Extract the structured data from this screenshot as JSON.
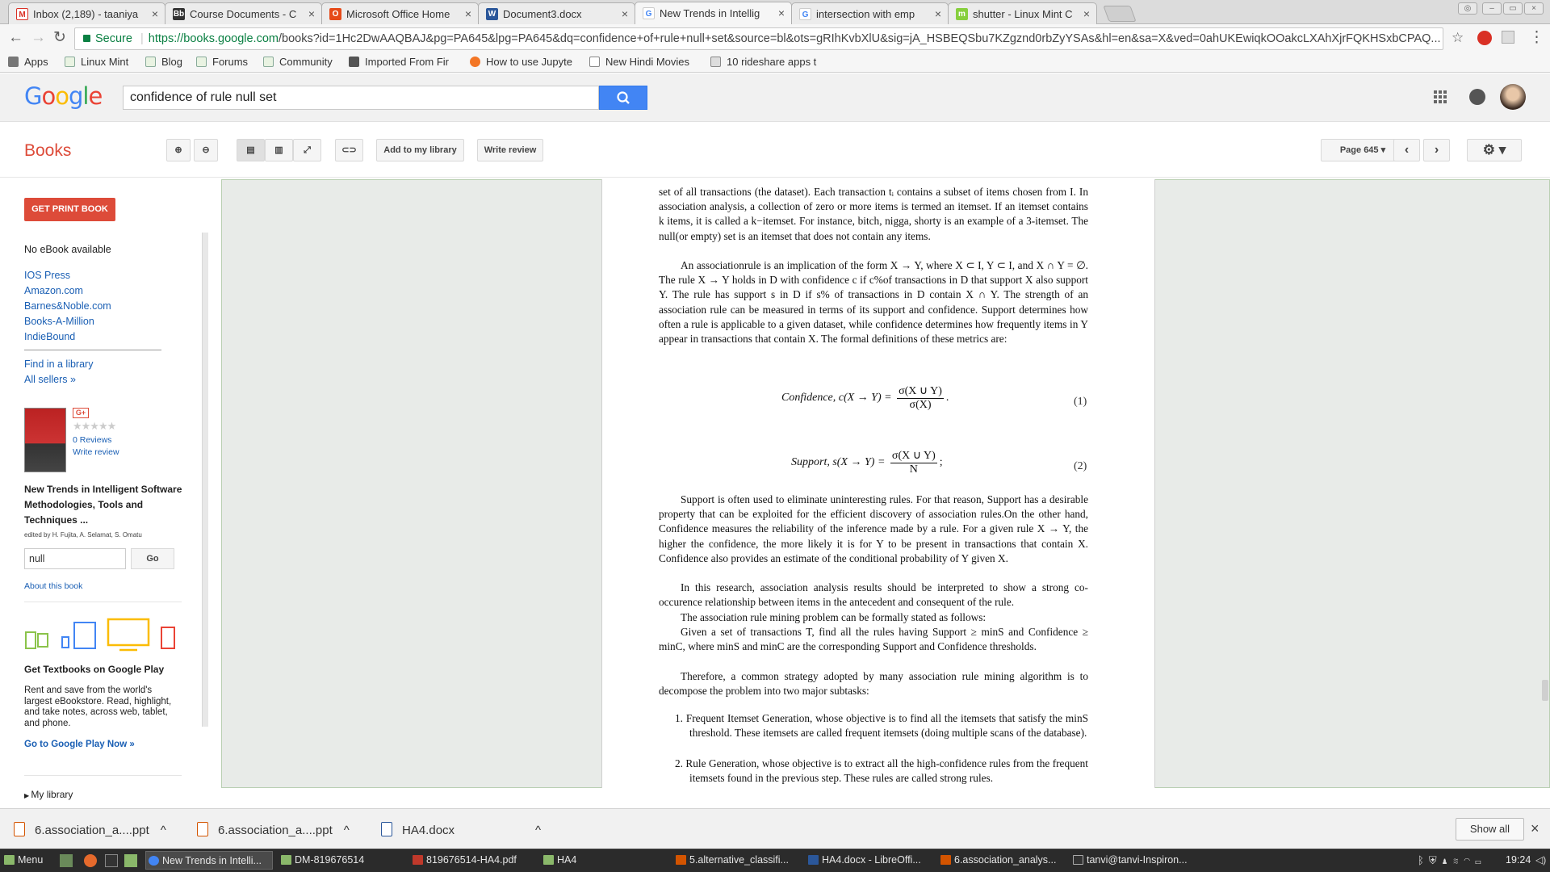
{
  "browser": {
    "tabs": [
      {
        "label": "Inbox (2,189) - taaniya",
        "icon": "gmail-icon",
        "color": "#d93025"
      },
      {
        "label": "Course Documents - C",
        "icon": "blackboard-icon",
        "color": "#333333"
      },
      {
        "label": "Microsoft Office Home",
        "icon": "office-icon",
        "color": "#e64a19"
      },
      {
        "label": "Document3.docx",
        "icon": "word-icon",
        "color": "#2b579a"
      },
      {
        "label": "New Trends in Intellig",
        "icon": "google-icon",
        "color": "#4285f4"
      },
      {
        "label": "intersection with emp",
        "icon": "google-icon",
        "color": "#4285f4"
      },
      {
        "label": "shutter - Linux Mint C",
        "icon": "mint-icon",
        "color": "#87cf3e"
      }
    ],
    "secure_label": "Secure",
    "url_host": "https://books.google.com",
    "url_rest": "/books?id=1Hc2DwAAQBAJ&pg=PA645&lpg=PA645&dq=confidence+of+rule+null+set&source=bl&ots=gRIhKvbXlU&sig=jA_HSBEQSbu7KZgznd0rbZyYSAs&hl=en&sa=X&ved=0ahUKEwiqkOOakcLXAhXjrFQKHSxbCPAQ...",
    "bookmarks": [
      {
        "label": "Apps"
      },
      {
        "label": "Linux Mint"
      },
      {
        "label": "Blog"
      },
      {
        "label": "Forums"
      },
      {
        "label": "Community"
      },
      {
        "label": "Imported From Fir"
      },
      {
        "label": "How to use Jupyte"
      },
      {
        "label": "New Hindi Movies"
      },
      {
        "label": "10 rideshare apps t"
      }
    ]
  },
  "google": {
    "logo": "Google",
    "query": "confidence of rule null set",
    "section": "Books"
  },
  "toolbar": {
    "add_library": "Add to my library",
    "write_review": "Write review",
    "page_label": "Page 645"
  },
  "sidebar": {
    "get_print": "GET PRINT BOOK",
    "no_ebook": "No eBook available",
    "sellers": [
      "IOS Press",
      "Amazon.com",
      "Barnes&Noble.com",
      "Books-A-Million",
      "IndieBound"
    ],
    "find_library": "Find in a library",
    "all_sellers": "All sellers »",
    "gplus": "G+",
    "stars": "★★★★★",
    "reviews": "0 Reviews",
    "write_review": "Write review",
    "book_title": "New Trends in Intelligent Software Methodologies, Tools and Techniques ...",
    "editors": "edited by H. Fujita, A. Selamat, S. Omatu",
    "search_value": "null",
    "go": "Go",
    "about": "About this book",
    "gp_title": "Get Textbooks on Google Play",
    "gp_text": "Rent and save from the world's largest eBookstore. Read, highlight, and take notes, across web, tablet, and phone.",
    "gp_link": "Go to Google Play Now »",
    "my_library": "My library"
  },
  "page": {
    "p1": "set of all transactions (the dataset). Each transaction tᵢ contains a subset of items chosen from I. In association analysis, a collection of zero or more items is termed an itemset. If an itemset contains k items, it is called a k−itemset. For instance, bitch, nigga, shorty is an example of a 3-itemset. The null(or empty) set is an itemset that does not contain any items.",
    "p2": "An associationrule is an implication of the form X → Y, where X ⊂ I, Y ⊂ I, and X ∩ Y = ∅. The rule X → Y holds in D with confidence c if c%of transactions in D that support X also support Y. The rule has support s in D if s% of transactions in D contain X ∩ Y. The strength of an association rule can be measured in terms of its support and confidence. Support determines how often a rule is applicable to a given dataset, while confidence determines how frequently items in Y appear in transactions that contain X. The formal definitions of these metrics are:",
    "eq1_lhs": "Confidence, c(X → Y) =",
    "eq1_num": "σ(X ∪ Y)",
    "eq1_den": "σ(X)",
    "eq1_tail": ".",
    "eq1_no": "(1)",
    "eq2_lhs": "Support, s(X → Y) =",
    "eq2_num": "σ(X ∪ Y)",
    "eq2_den": "N",
    "eq2_tail": ";",
    "eq2_no": "(2)",
    "p3": "Support is often used to eliminate uninteresting rules. For that reason, Support has a desirable property that can be exploited for the efficient discovery of association rules.On the other hand, Confidence measures the reliability of the inference made by a rule. For a given rule X → Y, the higher the confidence, the more likely it is for Y to be present in transactions that contain X. Confidence also provides an estimate of the conditional probability of Y given X.",
    "p4": "In this research, association analysis results should be interpreted to show a strong co-occurence relationship between items in the antecedent and consequent of the rule.",
    "p5": "The association rule mining problem can be formally stated as follows:",
    "p6": "Given a set of transactions T, find all the rules having Support ≥ minS and Confidence ≥ minC, where minS and minC are the corresponding Support and Confidence thresholds.",
    "p7": "Therefore, a common strategy adopted by many association rule mining algorithm is to decompose the problem into two major subtasks:",
    "list": [
      "1. Frequent Itemset Generation, whose objective is to find all the itemsets that satisfy the minS threshold. These itemsets are called frequent itemsets (doing multiple scans of the database).",
      "2. Rule Generation, whose objective is to extract all the high-confidence rules from the frequent itemsets found in the previous step. These rules are called strong rules."
    ]
  },
  "downloads": {
    "items": [
      "6.association_a....ppt",
      "6.association_a....ppt",
      "HA4.docx"
    ],
    "show_all": "Show all"
  },
  "taskbar": {
    "menu": "Menu",
    "tasks": [
      "New Trends in Intelli...",
      "DM-819676514",
      "819676514-HA4.pdf",
      "HA4",
      "5.alternative_classifi...",
      "HA4.docx - LibreOffi...",
      "6.association_analys...",
      "tanvi@tanvi-Inspiron..."
    ],
    "clock": "19:24"
  },
  "colors": {
    "accent": "#dd4b39",
    "link": "#1a5fb4",
    "search_button": "#4285f4"
  }
}
